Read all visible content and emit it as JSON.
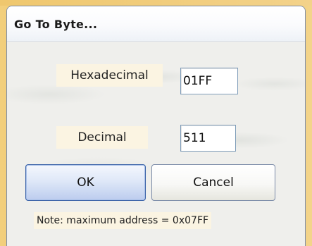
{
  "dialog": {
    "title": "Go To Byte...",
    "hex_label": "Hexadecimal",
    "hex_value": "01FF",
    "dec_label": "Decimal",
    "dec_value": "511",
    "ok_label": "OK",
    "cancel_label": "Cancel",
    "note": "Note: maximum address = 0x07FF"
  },
  "colors": {
    "background": "#eec56a",
    "label_bg": "#fbf4e2",
    "input_border": "#7f9db9",
    "ok_border": "#3a62a8"
  }
}
